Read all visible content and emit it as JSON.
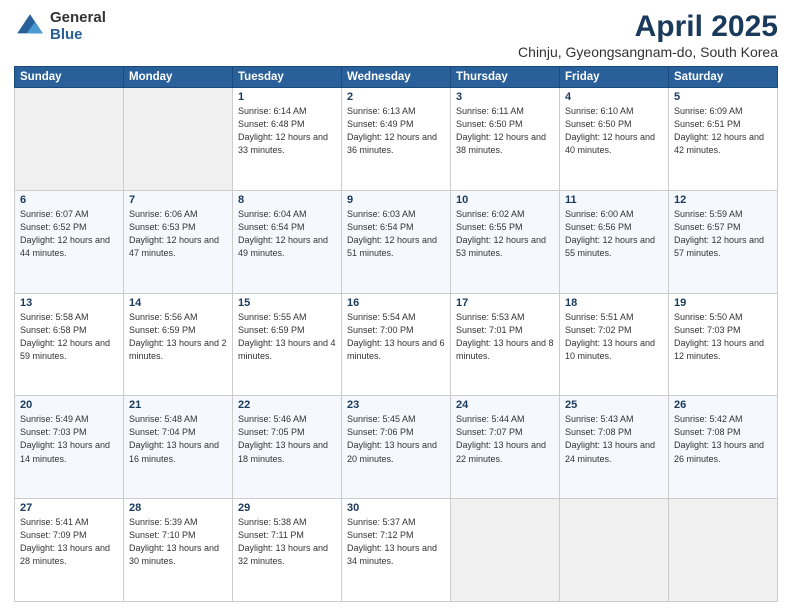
{
  "header": {
    "logo_general": "General",
    "logo_blue": "Blue",
    "month_title": "April 2025",
    "location": "Chinju, Gyeongsangnam-do, South Korea"
  },
  "days_of_week": [
    "Sunday",
    "Monday",
    "Tuesday",
    "Wednesday",
    "Thursday",
    "Friday",
    "Saturday"
  ],
  "weeks": [
    [
      {
        "day": "",
        "empty": true
      },
      {
        "day": "",
        "empty": true
      },
      {
        "day": "1",
        "sunrise": "6:14 AM",
        "sunset": "6:48 PM",
        "daylight": "12 hours and 33 minutes."
      },
      {
        "day": "2",
        "sunrise": "6:13 AM",
        "sunset": "6:49 PM",
        "daylight": "12 hours and 36 minutes."
      },
      {
        "day": "3",
        "sunrise": "6:11 AM",
        "sunset": "6:50 PM",
        "daylight": "12 hours and 38 minutes."
      },
      {
        "day": "4",
        "sunrise": "6:10 AM",
        "sunset": "6:50 PM",
        "daylight": "12 hours and 40 minutes."
      },
      {
        "day": "5",
        "sunrise": "6:09 AM",
        "sunset": "6:51 PM",
        "daylight": "12 hours and 42 minutes."
      }
    ],
    [
      {
        "day": "6",
        "sunrise": "6:07 AM",
        "sunset": "6:52 PM",
        "daylight": "12 hours and 44 minutes."
      },
      {
        "day": "7",
        "sunrise": "6:06 AM",
        "sunset": "6:53 PM",
        "daylight": "12 hours and 47 minutes."
      },
      {
        "day": "8",
        "sunrise": "6:04 AM",
        "sunset": "6:54 PM",
        "daylight": "12 hours and 49 minutes."
      },
      {
        "day": "9",
        "sunrise": "6:03 AM",
        "sunset": "6:54 PM",
        "daylight": "12 hours and 51 minutes."
      },
      {
        "day": "10",
        "sunrise": "6:02 AM",
        "sunset": "6:55 PM",
        "daylight": "12 hours and 53 minutes."
      },
      {
        "day": "11",
        "sunrise": "6:00 AM",
        "sunset": "6:56 PM",
        "daylight": "12 hours and 55 minutes."
      },
      {
        "day": "12",
        "sunrise": "5:59 AM",
        "sunset": "6:57 PM",
        "daylight": "12 hours and 57 minutes."
      }
    ],
    [
      {
        "day": "13",
        "sunrise": "5:58 AM",
        "sunset": "6:58 PM",
        "daylight": "12 hours and 59 minutes."
      },
      {
        "day": "14",
        "sunrise": "5:56 AM",
        "sunset": "6:59 PM",
        "daylight": "13 hours and 2 minutes."
      },
      {
        "day": "15",
        "sunrise": "5:55 AM",
        "sunset": "6:59 PM",
        "daylight": "13 hours and 4 minutes."
      },
      {
        "day": "16",
        "sunrise": "5:54 AM",
        "sunset": "7:00 PM",
        "daylight": "13 hours and 6 minutes."
      },
      {
        "day": "17",
        "sunrise": "5:53 AM",
        "sunset": "7:01 PM",
        "daylight": "13 hours and 8 minutes."
      },
      {
        "day": "18",
        "sunrise": "5:51 AM",
        "sunset": "7:02 PM",
        "daylight": "13 hours and 10 minutes."
      },
      {
        "day": "19",
        "sunrise": "5:50 AM",
        "sunset": "7:03 PM",
        "daylight": "13 hours and 12 minutes."
      }
    ],
    [
      {
        "day": "20",
        "sunrise": "5:49 AM",
        "sunset": "7:03 PM",
        "daylight": "13 hours and 14 minutes."
      },
      {
        "day": "21",
        "sunrise": "5:48 AM",
        "sunset": "7:04 PM",
        "daylight": "13 hours and 16 minutes."
      },
      {
        "day": "22",
        "sunrise": "5:46 AM",
        "sunset": "7:05 PM",
        "daylight": "13 hours and 18 minutes."
      },
      {
        "day": "23",
        "sunrise": "5:45 AM",
        "sunset": "7:06 PM",
        "daylight": "13 hours and 20 minutes."
      },
      {
        "day": "24",
        "sunrise": "5:44 AM",
        "sunset": "7:07 PM",
        "daylight": "13 hours and 22 minutes."
      },
      {
        "day": "25",
        "sunrise": "5:43 AM",
        "sunset": "7:08 PM",
        "daylight": "13 hours and 24 minutes."
      },
      {
        "day": "26",
        "sunrise": "5:42 AM",
        "sunset": "7:08 PM",
        "daylight": "13 hours and 26 minutes."
      }
    ],
    [
      {
        "day": "27",
        "sunrise": "5:41 AM",
        "sunset": "7:09 PM",
        "daylight": "13 hours and 28 minutes."
      },
      {
        "day": "28",
        "sunrise": "5:39 AM",
        "sunset": "7:10 PM",
        "daylight": "13 hours and 30 minutes."
      },
      {
        "day": "29",
        "sunrise": "5:38 AM",
        "sunset": "7:11 PM",
        "daylight": "13 hours and 32 minutes."
      },
      {
        "day": "30",
        "sunrise": "5:37 AM",
        "sunset": "7:12 PM",
        "daylight": "13 hours and 34 minutes."
      },
      {
        "day": "",
        "empty": true
      },
      {
        "day": "",
        "empty": true
      },
      {
        "day": "",
        "empty": true
      }
    ]
  ]
}
